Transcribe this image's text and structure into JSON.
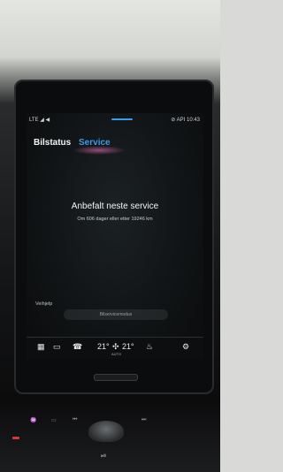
{
  "statusbar": {
    "left": "LTE ◢ ◀",
    "right": "⊘ API  10:43"
  },
  "tabs": [
    {
      "label": "Bilstatus",
      "active": false
    },
    {
      "label": "Service",
      "active": true
    }
  ],
  "main": {
    "heading": "Anbefalt neste service",
    "subtext": "Om 606 dager eller etter 19246 km"
  },
  "help_link": "Veihjelp",
  "service_button": "Bilservicemodus",
  "climate": {
    "left_temp": "21°",
    "right_temp": "21°",
    "auto_label": "AUTO"
  },
  "colors": {
    "accent": "#3d9be9"
  }
}
